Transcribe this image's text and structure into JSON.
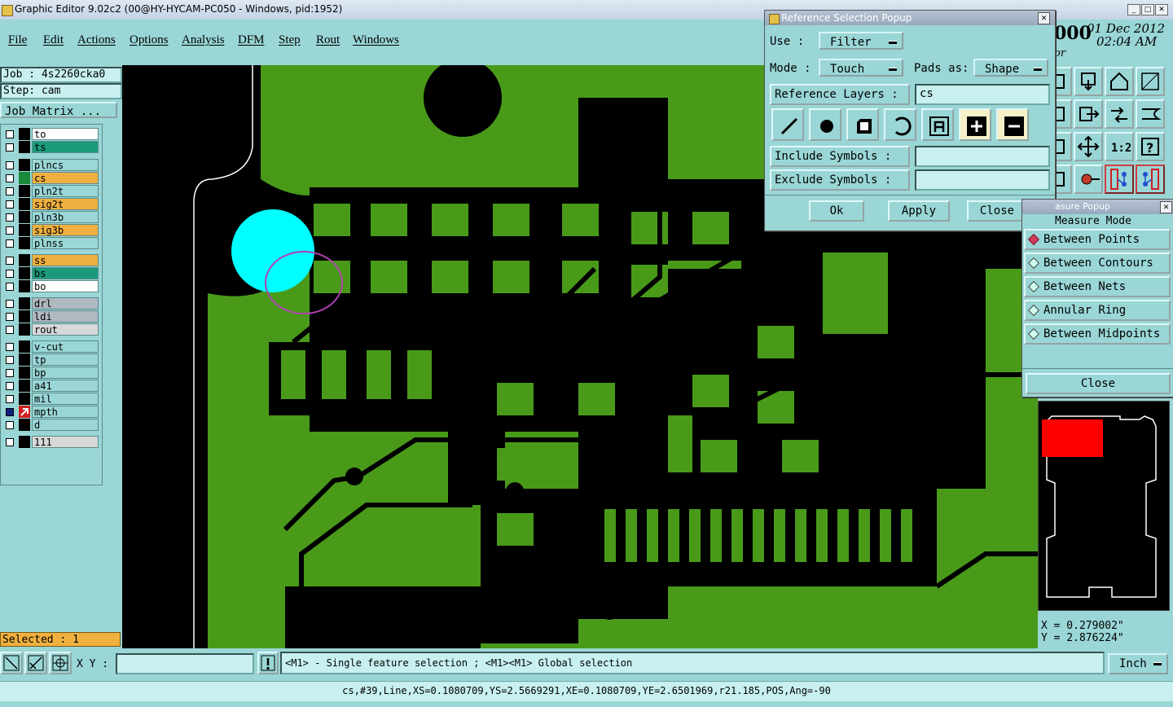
{
  "window": {
    "title": "Graphic Editor 9.02c2 (00@HY-HYCAM-PC050 - Windows, pid:1952)"
  },
  "menu": {
    "items": [
      "File",
      "Edit",
      "Actions",
      "Options",
      "Analysis",
      "DFM",
      "Step",
      "Rout",
      "Windows"
    ]
  },
  "job": {
    "job_label": "Job : 4s2260cka0",
    "step_label": "Step: cam",
    "matrix_button": "Job Matrix ..."
  },
  "layers": [
    {
      "name": "to",
      "color": "#ffffff"
    },
    {
      "name": "ts",
      "color": "#1a9a7a"
    },
    {
      "name": "plncs",
      "color": "#9ad6d6"
    },
    {
      "name": "cs",
      "color": "#f0b040"
    },
    {
      "name": "pln2t",
      "color": "#9ad6d6"
    },
    {
      "name": "sig2t",
      "color": "#f0b040"
    },
    {
      "name": "pln3b",
      "color": "#9ad6d6"
    },
    {
      "name": "sig3b",
      "color": "#f0b040"
    },
    {
      "name": "plnss",
      "color": "#9ad6d6"
    },
    {
      "name": "ss",
      "color": "#f0b040"
    },
    {
      "name": "bs",
      "color": "#1a9a7a"
    },
    {
      "name": "bo",
      "color": "#ffffff"
    },
    {
      "name": "drl",
      "color": "#b0b8c0"
    },
    {
      "name": "ldi",
      "color": "#b0b8c0"
    },
    {
      "name": "rout",
      "color": "#d8d8d8"
    },
    {
      "name": "v-cut",
      "color": "#9ad6d6"
    },
    {
      "name": "tp",
      "color": "#9ad6d6"
    },
    {
      "name": "bp",
      "color": "#9ad6d6"
    },
    {
      "name": "a41",
      "color": "#9ad6d6"
    },
    {
      "name": "mil",
      "color": "#9ad6d6"
    },
    {
      "name": "mpth",
      "color": "#9ad6d6"
    },
    {
      "name": "d",
      "color": "#9ad6d6"
    },
    {
      "name": "111",
      "color": "#d8d8d8"
    }
  ],
  "selected_label": "Selected : 1",
  "clock": {
    "date": "01 Dec 2012",
    "time": "02:04 AM",
    "partial_left": "000",
    "partial_below": "or"
  },
  "ref_popup": {
    "title": "Reference Selection Popup",
    "use_label": "Use   :",
    "use_value": "Filter",
    "mode_label": "Mode :",
    "mode_value": "Touch",
    "pads_label": "Pads as:",
    "pads_value": "Shape",
    "ref_layers_label": "Reference Layers :",
    "ref_layers_value": "cs",
    "include_label": "Include Symbols :",
    "include_value": "",
    "exclude_label": "Exclude Symbols :",
    "exclude_value": "",
    "ok": "Ok",
    "apply": "Apply",
    "close": "Close"
  },
  "measure_popup": {
    "title": "Measure Popup",
    "title_visible": "asure Popup",
    "mode_label": "Measure Mode",
    "options": [
      {
        "label": "Between Points",
        "selected": true
      },
      {
        "label": "Between Contours",
        "selected": false
      },
      {
        "label": "Between Nets",
        "selected": false
      },
      {
        "label": "Annular Ring",
        "selected": false
      },
      {
        "label": "Between Midpoints",
        "selected": false
      }
    ],
    "close": "Close"
  },
  "coords": {
    "x": "X = 0.279002\"",
    "y": "Y = 2.876224\""
  },
  "bottom": {
    "xy_label": "X Y :",
    "xy_value": "",
    "hint": "<M1> - Single feature selection ; <M1><M1> Global selection",
    "units": "Inch"
  },
  "status": {
    "text": "cs,#39,Line,XS=0.1080709,YS=2.5669291,XE=0.1080709,YE=2.6501969,r21.185,POS,Ang=-90"
  },
  "colors": {
    "copper": "#4a9a1a",
    "background": "#000000",
    "highlight": "#00ffff",
    "marker": "#b040b0",
    "panel": "#9ad6d6"
  }
}
